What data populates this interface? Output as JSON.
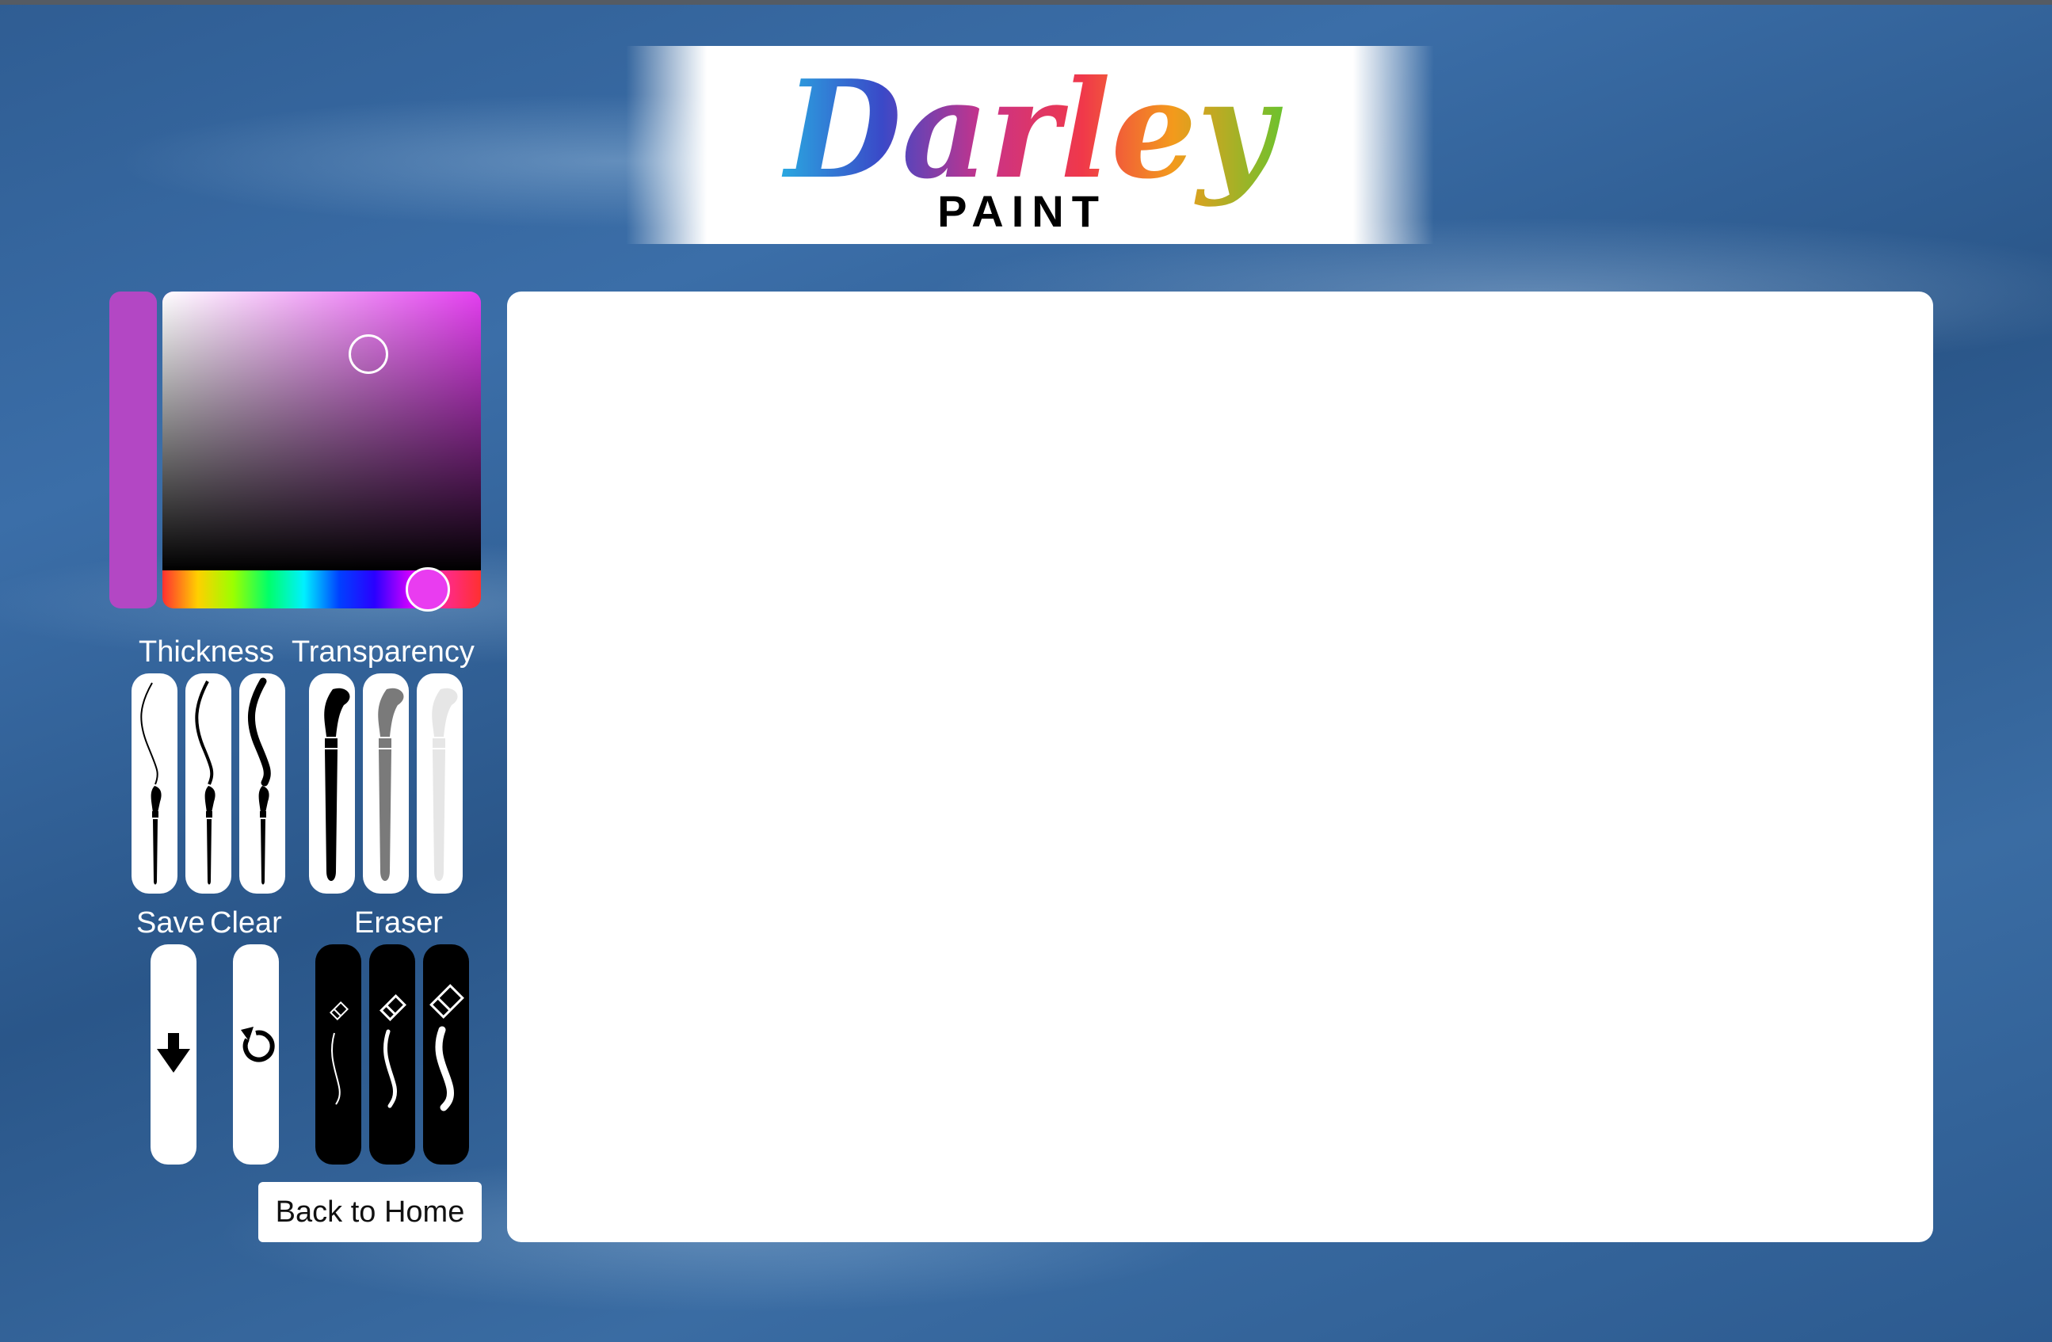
{
  "logo": {
    "name": "Darley",
    "sub": "PAINT"
  },
  "color_picker": {
    "current_color": "#b347c4",
    "hue_color": "#e93cf0",
    "sv_base": "#e43ff0"
  },
  "labels": {
    "thickness": "Thickness",
    "transparency": "Transparency",
    "save": "Save",
    "clear": "Clear",
    "eraser": "Eraser"
  },
  "tools": {
    "thickness": [
      "thin-brush-icon",
      "medium-brush-icon",
      "thick-brush-icon"
    ],
    "transparency": [
      "opaque-brush-icon",
      "half-transparent-brush-icon",
      "transparent-brush-icon"
    ],
    "save_icon": "download-arrow-icon",
    "clear_icon": "refresh-icon",
    "eraser": [
      "small-eraser-icon",
      "medium-eraser-icon",
      "large-eraser-icon"
    ]
  },
  "buttons": {
    "back_home": "Back to Home"
  }
}
